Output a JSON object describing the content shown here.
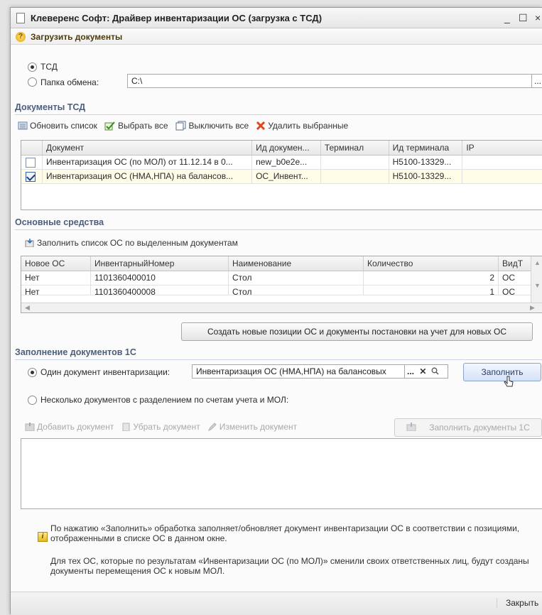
{
  "window": {
    "title": "Клеверенс Софт: Драйвер инвентаризации ОС (загрузка с ТСД)",
    "controls": [
      "_",
      "☐",
      "×"
    ]
  },
  "command": {
    "help_icon": "?",
    "label": "Загрузить документы"
  },
  "source": {
    "tsd_label": "ТСД",
    "folder_label": "Папка обмена:",
    "folder_value": "C:\\",
    "browse": "..."
  },
  "tsd_docs": {
    "title": "Документы ТСД",
    "toolbar": {
      "refresh": "Обновить список",
      "select_all": "Выбрать все",
      "deselect_all": "Выключить все",
      "delete": "Удалить выбранные"
    },
    "columns": [
      "Документ",
      "Ид докумен...",
      "Терминал",
      "Ид терминала",
      "IP"
    ],
    "rows": [
      {
        "checked": false,
        "doc": "Инвентаризация ОС (по МОЛ) от 11.12.14 в 0...",
        "doc_id": "new_b0e2e...",
        "terminal": "",
        "terminal_id": "H5100-13329...",
        "ip": ""
      },
      {
        "checked": true,
        "doc": "Инвентаризация ОС (НМА,НПА) на балансов...",
        "doc_id": "ОС_Инвент...",
        "terminal": "",
        "terminal_id": "H5100-13329...",
        "ip": ""
      }
    ]
  },
  "assets": {
    "title": "Основные средства",
    "fill_button": "Заполнить список ОС по выделенным документам",
    "columns": [
      "Новое ОС",
      "ИнвентарныйНомер",
      "Наименование",
      "Количество",
      "ВидТ"
    ],
    "rows": [
      {
        "new": "Нет",
        "inv": "1101360400010",
        "name": "Стол",
        "qty": "2",
        "kind": "ОС"
      },
      {
        "new": "Нет",
        "inv": "1101360400008",
        "name": "Стол",
        "qty": "1",
        "kind": "ОС"
      }
    ],
    "create_button": "Создать новые позиции ОС и документы постановки на учет для новых ОС"
  },
  "fill1c": {
    "title": "Заполнение документов 1С",
    "single_label": "Один документ инвентаризации:",
    "single_value": "Инвентаризация ОС (НМА,НПА) на балансовых",
    "fill_button": "Заполнить",
    "multi_label": "Несколько документов с разделением по счетам учета и МОЛ:",
    "toolbar": {
      "add": "Добавить документ",
      "remove": "Убрать документ",
      "edit": "Изменить документ",
      "fill_docs": "Заполнить документы 1С"
    }
  },
  "info": {
    "p1": "По нажатию «Заполнить» обработка заполняет/обновляет документ инвентаризации ОС в соответствии с позициями, отображенными в списке ОС в данном окне.",
    "p2": "Для тех ОС, которые по результатам «Инвентаризации ОС (по МОЛ)» сменили своих ответственных лиц, будут созданы документы перемещения ОС к новым МОЛ."
  },
  "footer": {
    "close": "Закрыть"
  }
}
